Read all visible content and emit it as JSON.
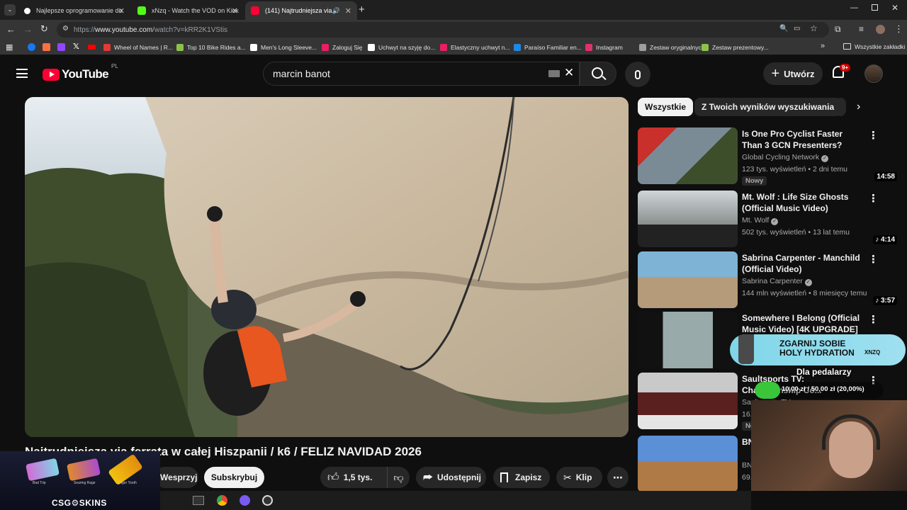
{
  "browser": {
    "tabs": [
      {
        "label": "Najlepsze oprogramowanie do",
        "favicon_color": "#ffffff"
      },
      {
        "label": "xNzq - Watch the VOD on Kick",
        "favicon_color": "#53fc18"
      },
      {
        "label": "(141) Najtrudniejsza via fer",
        "favicon_color": "#ff0033"
      }
    ],
    "url_prefix": "https://",
    "url_domain": "www.youtube.com",
    "url_path": "/watch?v=kRR2K1VStis",
    "bookmarks": [
      {
        "label": "Wheel of Names | R...",
        "color": "#e53935"
      },
      {
        "label": "Top 10 Bike Rides a...",
        "color": "#8bc34a"
      },
      {
        "label": "Men's Long Sleeve...",
        "color": "#ffffff"
      },
      {
        "label": "Zaloguj Się",
        "color": "#e91e63"
      },
      {
        "label": "Uchwyt na szyję do...",
        "color": "#ffffff"
      },
      {
        "label": "Elastyczny uchwyt n...",
        "color": "#e91e63"
      },
      {
        "label": "Paraíso Familiar en...",
        "color": "#1e88e5"
      },
      {
        "label": "Instagram",
        "color": "#e1306c"
      },
      {
        "label": "Zestaw oryginalnyc...",
        "color": "#9e9e9e"
      },
      {
        "label": "Zestaw prezentowy...",
        "color": "#8bc34a"
      }
    ],
    "all_bookmarks": "Wszystkie zakładki"
  },
  "youtube": {
    "logo_text": "YouTube",
    "region": "PL",
    "search_value": "marcin banot",
    "create_label": "Utwórz",
    "notif_count": "9+"
  },
  "video": {
    "title": "Najtrudniejsza via ferrata w całej Hiszpanii / k6 / FELIZ NAVIDAD 2026",
    "support_label": "Wesprzyj",
    "subscribe_label": "Subskrybuj",
    "likes": "1,5 tys.",
    "share_label": "Udostępnij",
    "save_label": "Zapisz",
    "clip_label": "Klip"
  },
  "filters": {
    "all": "Wszystkie",
    "from_results": "Z Twoich wyników wyszukiwania"
  },
  "recommendations": [
    {
      "title": "Is One Pro Cyclist Faster Than 3 GCN Presenters?",
      "channel": "Global Cycling Network",
      "meta": "123 tys. wyświetleń • 2 dni temu",
      "duration": "14:58",
      "badge": "Nowy",
      "music": false
    },
    {
      "title": "Mt. Wolf : Life Size Ghosts (Official Music Video)",
      "channel": "Mt. Wolf",
      "meta": "502 tys. wyświetleń • 13 lat temu",
      "duration": "4:14",
      "music": true
    },
    {
      "title": "Sabrina Carpenter - Manchild (Official Video)",
      "channel": "Sabrina Carpenter",
      "meta": "144 mln wyświetleń • 8 miesięcy temu",
      "duration": "3:57",
      "music": true
    },
    {
      "title": "Somewhere I Belong (Official Music Video) [4K UPGRADE] –...",
      "channel": "",
      "meta": "",
      "duration": "3:46",
      "music": true
    },
    {
      "title": "Saultsports TV: Championship Co...",
      "channel": "Saultsports TV",
      "meta": "16...",
      "duration": "2:40",
      "badge": "No",
      "music": false
    },
    {
      "title": "BN... sp...",
      "channel": "BN...",
      "meta": "69...",
      "duration": "29:56",
      "music": false
    }
  ],
  "overlay": {
    "promo_line1": "ZGARNIJ SOBIE",
    "promo_line2": "HOLY HYDRATION",
    "promo_code": "XNZQ",
    "goal_title": "Dla pedalarzy",
    "goal_progress": "10,00 zł / 50,00 zł (20,00%)",
    "goal_fraction": 0.2,
    "skins_brand": "CSG⚙SKINS",
    "skins": [
      "Bad Trip",
      "Searing Rage",
      "Tiger Tooth"
    ]
  }
}
